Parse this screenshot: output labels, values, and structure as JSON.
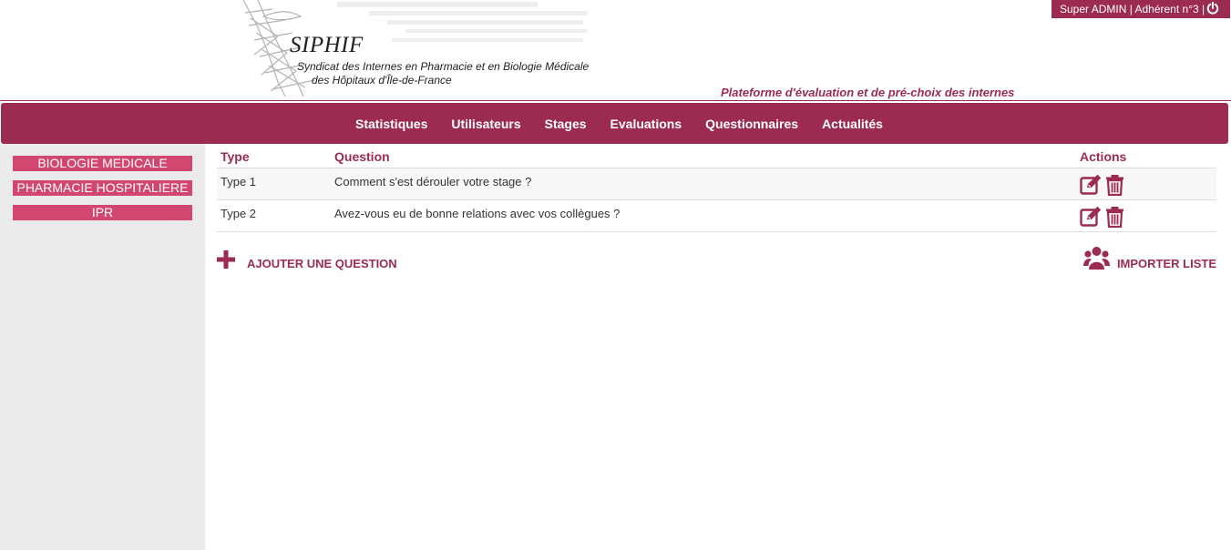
{
  "header": {
    "logo_title": "SIPHIF",
    "logo_subtitle_line1": "Syndicat des Internes en Pharmacie et en Biologie Médicale",
    "logo_subtitle_line2": "des Hôpitaux d'Île-de-France",
    "tagline": "Plateforme d'évaluation et de pré-choix des internes",
    "user_label": "Super ADMIN | Adhérent n°3 |"
  },
  "nav": {
    "items": [
      "Statistiques",
      "Utilisateurs",
      "Stages",
      "Evaluations",
      "Questionnaires",
      "Actualités"
    ]
  },
  "sidebar": {
    "items": [
      "BIOLOGIE MEDICALE",
      "PHARMACIE HOSPITALIERE",
      "IPR"
    ]
  },
  "table": {
    "headers": {
      "type": "Type",
      "question": "Question",
      "actions": "Actions"
    },
    "rows": [
      {
        "type": "Type 1",
        "question": "Comment s'est dérouler votre stage ?"
      },
      {
        "type": "Type 2",
        "question": "Avez-vous eu de bonne relations avec vos collègues ?"
      }
    ]
  },
  "actions": {
    "add_question": "AJOUTER UNE QUESTION",
    "import_list": "IMPORTER LISTE"
  },
  "colors": {
    "brand": "#9c2b52",
    "sidebar_button": "#d1476f",
    "sidebar_bg": "#ebebeb"
  },
  "icons": [
    "power-icon",
    "edit-icon",
    "trash-icon",
    "plus-icon",
    "users-icon"
  ]
}
